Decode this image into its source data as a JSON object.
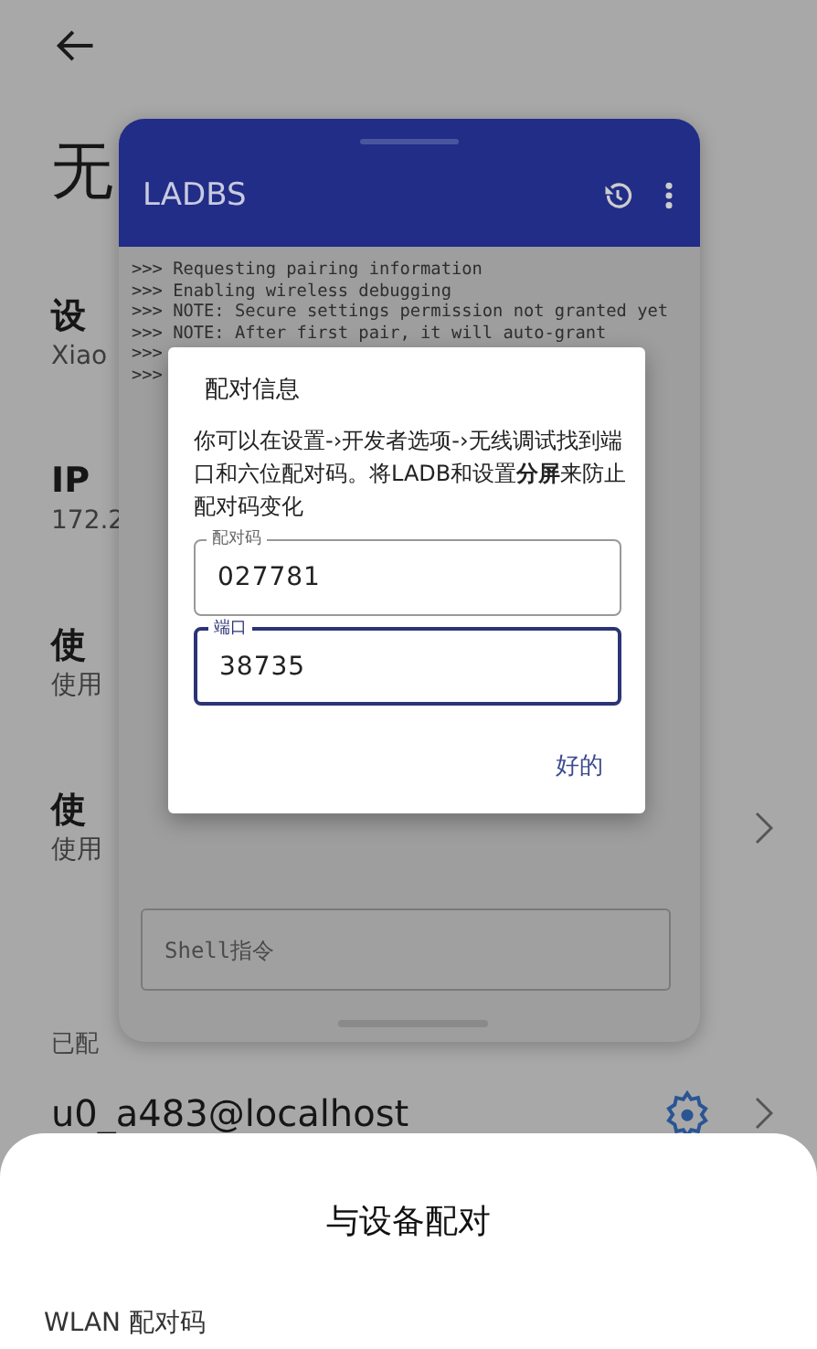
{
  "page": {
    "title": "无",
    "sections": [
      {
        "heading": "设",
        "value": "Xiao",
        "chevron": false
      },
      {
        "heading": "IP",
        "value": "172.2",
        "chevron": false
      },
      {
        "heading": "使",
        "value": "使用",
        "chevron": false
      },
      {
        "heading": "使",
        "value": "使用",
        "chevron": true
      }
    ],
    "paired_label": "已配",
    "paired_device": "u0_a483@localhost"
  },
  "app_window": {
    "title": "LADBS",
    "console": [
      ">>> Requesting pairing information",
      ">>> Enabling wireless debugging",
      ">>> NOTE: Secure settings permission not granted yet",
      ">>> NOTE: After first pair, it will auto-grant",
      ">>>",
      ">>>"
    ],
    "command_field": {
      "placeholder": "Shell指令"
    }
  },
  "dialog": {
    "title": "配对信息",
    "message": "你可以在设置-›开发者选项-›无线调试找到端口和六位配对码。将LADB和设置**分屏**来防止配对码变化",
    "fields": [
      {
        "label": "配对码",
        "value": "027781",
        "focused": false
      },
      {
        "label": "端口",
        "value": "38735",
        "focused": true
      }
    ],
    "button": "好的"
  },
  "sheet": {
    "title": "与设备配对",
    "subtitle": "WLAN 配对码"
  }
}
